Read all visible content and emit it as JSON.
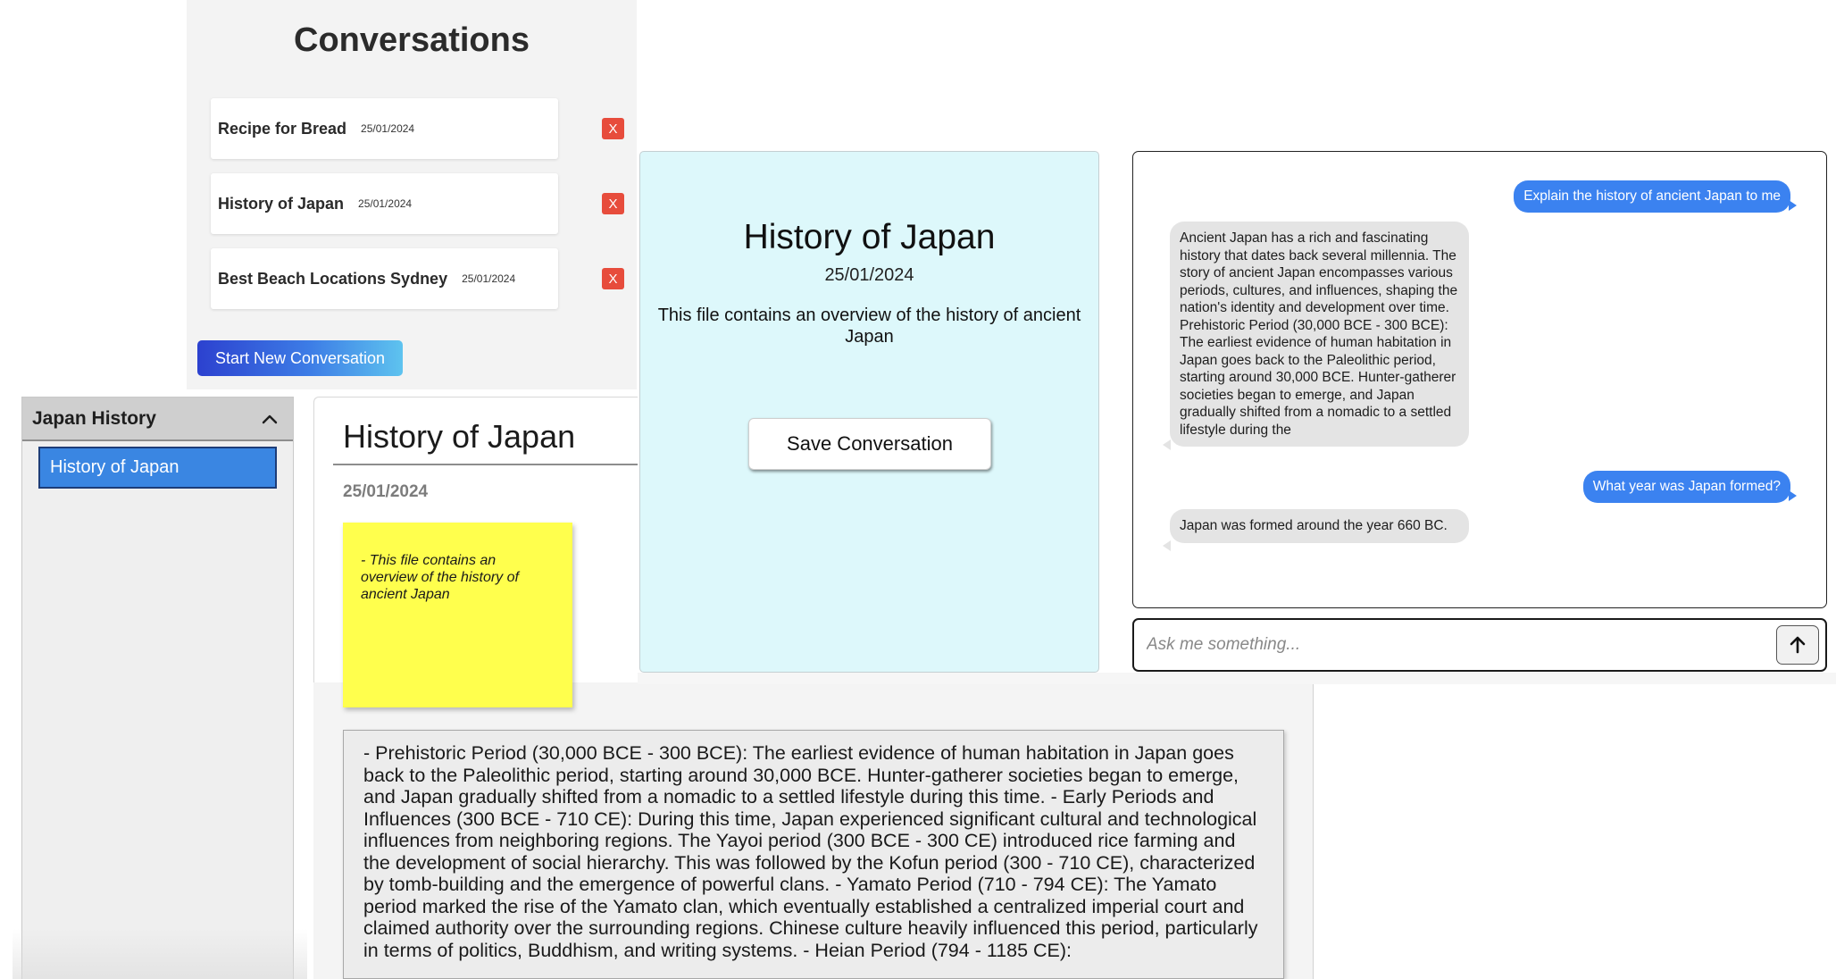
{
  "conversations": {
    "title": "Conversations",
    "items": [
      {
        "name": "Recipe for Bread",
        "date": "25/01/2024",
        "delete_label": "X"
      },
      {
        "name": "History of Japan",
        "date": "25/01/2024",
        "delete_label": "X"
      },
      {
        "name": "Best Beach Locations Sydney",
        "date": "25/01/2024",
        "delete_label": "X"
      }
    ],
    "new_button": "Start New Conversation"
  },
  "sidebar": {
    "folder": "Japan History",
    "toggle_icon": "chevron-up-icon",
    "items": [
      {
        "label": "History of Japan"
      }
    ]
  },
  "document": {
    "title": "History of Japan",
    "date": "25/01/2024",
    "note": "- This file contains an overview of the history of ancient Japan",
    "note_color": "#ffff4d",
    "body": "- Prehistoric Period (30,000 BCE - 300 BCE): The earliest evidence of human habitation in Japan goes back to the Paleolithic period, starting around 30,000 BCE. Hunter-gatherer societies began to emerge, and Japan gradually shifted from a nomadic to a settled lifestyle during this time. - Early Periods and Influences (300 BCE - 710 CE): During this time, Japan experienced significant cultural and technological influences from neighboring regions. The Yayoi period (300 BCE - 300 CE) introduced rice farming and the development of social hierarchy. This was followed by the Kofun period (300 - 710 CE), characterized by tomb-building and the emergence of powerful clans. - Yamato Period (710 - 794 CE): The Yamato period marked the rise of the Yamato clan, which eventually established a centralized imperial court and claimed authority over the surrounding regions. Chinese culture heavily influenced this period, particularly in terms of politics, Buddhism, and writing systems. - Heian Period (794 - 1185 CE):"
  },
  "detail": {
    "title": "History of Japan",
    "date": "25/01/2024",
    "description": "This file contains an overview of the history of ancient Japan",
    "save_button": "Save Conversation",
    "background": "#ddf8fb"
  },
  "chat": {
    "messages": [
      {
        "role": "user",
        "text": "Explain the history of ancient Japan to me"
      },
      {
        "role": "assistant",
        "text": "Ancient Japan has a rich and fascinating history that dates back several millennia. The story of ancient Japan encompasses various periods, cultures, and influences, shaping the nation's identity and development over time. Prehistoric Period (30,000 BCE - 300 BCE): The earliest evidence of human habitation in Japan goes back to the Paleolithic period, starting around 30,000 BCE. Hunter-gatherer societies began to emerge, and Japan gradually shifted from a nomadic to a settled lifestyle during the"
      },
      {
        "role": "user",
        "text": "What year was Japan formed?"
      },
      {
        "role": "assistant",
        "text": "Japan was formed around the year 660 BC."
      }
    ],
    "input_placeholder": "Ask me something...",
    "send_icon": "arrow-up-icon",
    "user_bubble_color": "#3b82f0",
    "assistant_bubble_color": "#e4e4e4"
  }
}
